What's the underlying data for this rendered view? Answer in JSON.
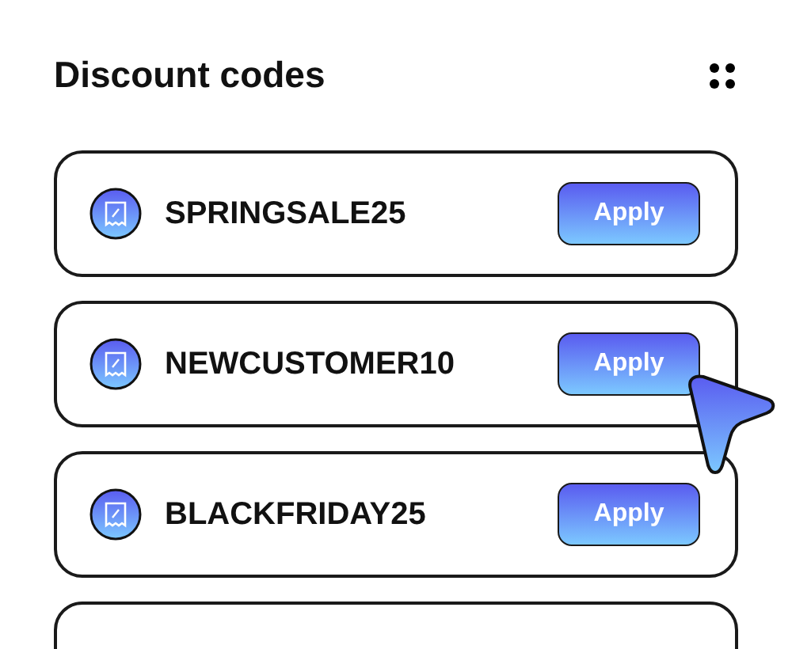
{
  "title": "Discount codes",
  "codes": [
    {
      "code": "SPRINGSALE25",
      "button": "Apply"
    },
    {
      "code": "NEWCUSTOMER10",
      "button": "Apply",
      "pointer": true
    },
    {
      "code": "BLACKFRIDAY25",
      "button": "Apply"
    }
  ]
}
